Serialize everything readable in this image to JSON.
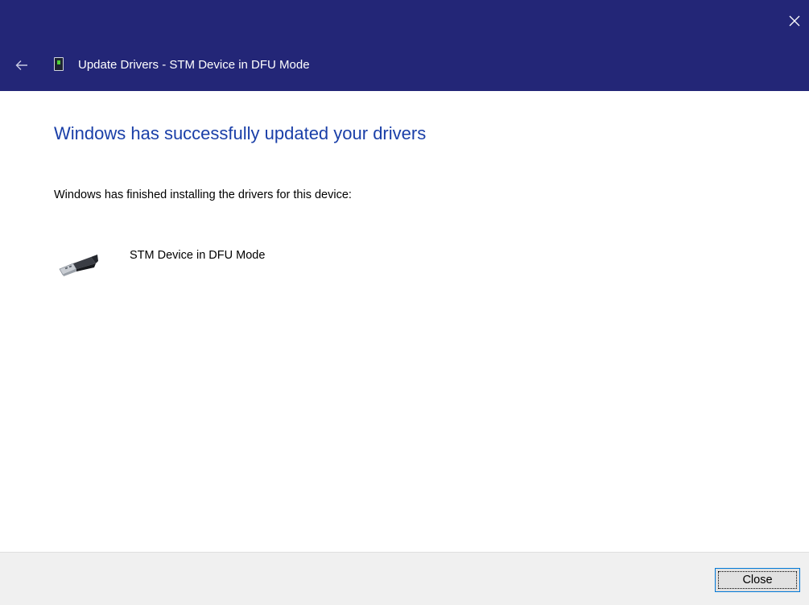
{
  "window": {
    "title": "Update Drivers - STM Device in DFU Mode",
    "header_color": "#232677",
    "close_glyph": "✕"
  },
  "content": {
    "heading": "Windows has successfully updated your drivers",
    "heading_color": "#1a3fa8",
    "description": "Windows has finished installing the drivers for this device:",
    "device": {
      "name": "STM Device in DFU Mode",
      "icon": "usb-plug-icon"
    }
  },
  "footer": {
    "close_label": "Close"
  },
  "icons": {
    "back": "back-arrow-icon",
    "window_close": "close-icon",
    "title_device": "device-manager-icon"
  }
}
